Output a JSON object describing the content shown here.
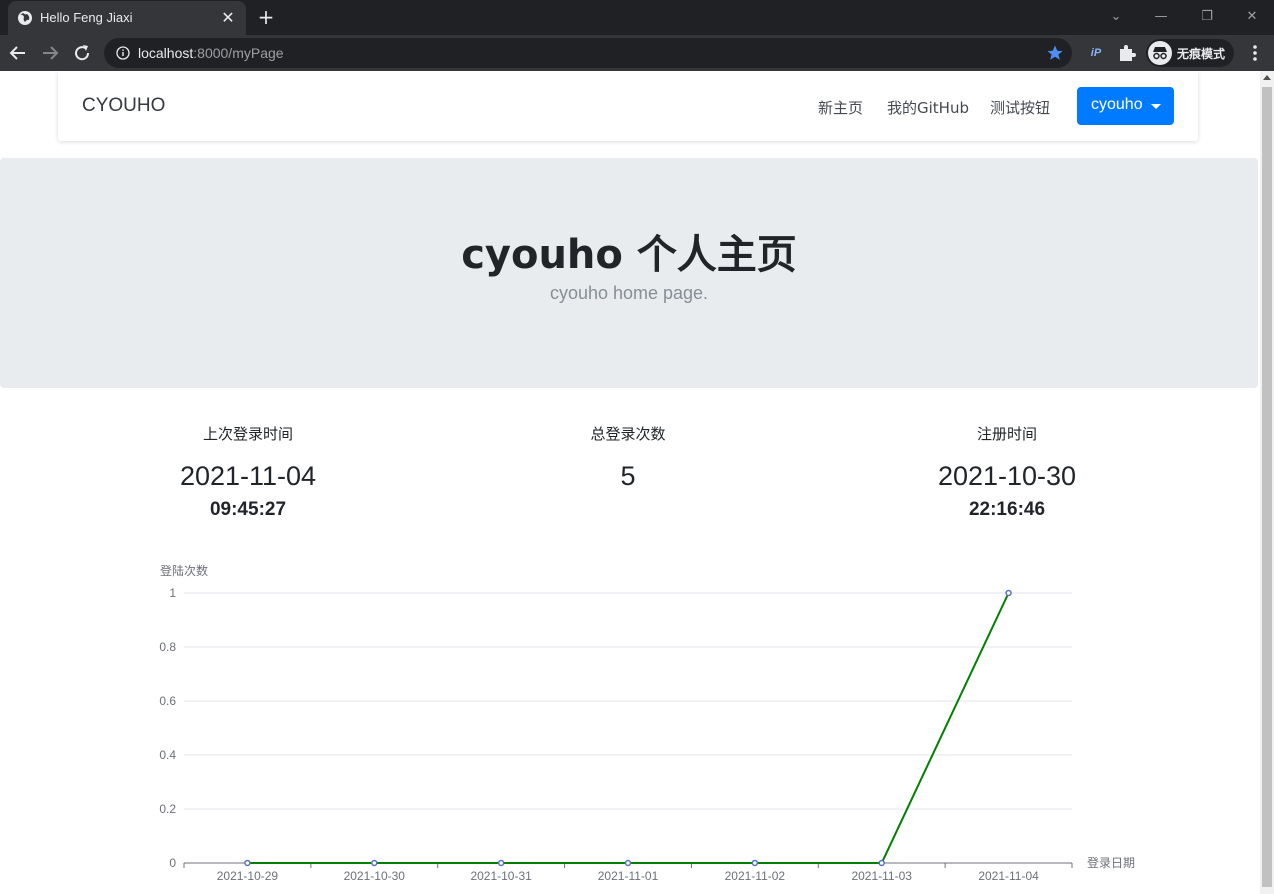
{
  "browser": {
    "tab_title": "Hello Feng Jiaxi",
    "url_host": "localhost",
    "url_rest": ":8000/myPage",
    "incognito_label": "无痕模式",
    "extension_label": "iP"
  },
  "navbar": {
    "brand": "CYOUHO",
    "links": [
      "新主页",
      "我的GitHub",
      "测试按钮"
    ],
    "user_menu": "cyouho"
  },
  "hero": {
    "title": "cyouho 个人主页",
    "subtitle": "cyouho home page."
  },
  "stats": [
    {
      "label": "上次登录时间",
      "value": "2021-11-04",
      "sub": "09:45:27"
    },
    {
      "label": "总登录次数",
      "value": "5",
      "sub": ""
    },
    {
      "label": "注册时间",
      "value": "2021-10-30",
      "sub": "22:16:46"
    }
  ],
  "colors": {
    "accent": "#007bff",
    "line": "#008000",
    "point": "#5470c6",
    "hero_bg": "#e9ecef"
  },
  "chart_data": {
    "type": "line",
    "ylabel": "登陆次数",
    "xlabel": "登录日期",
    "categories": [
      "2021-10-29",
      "2021-10-30",
      "2021-10-31",
      "2021-11-01",
      "2021-11-02",
      "2021-11-03",
      "2021-11-04"
    ],
    "values": [
      0,
      0,
      0,
      0,
      0,
      0,
      1
    ],
    "ylim": [
      0,
      1
    ],
    "yticks": [
      "0",
      "0.2",
      "0.4",
      "0.6",
      "0.8",
      "1"
    ],
    "grid": true
  }
}
